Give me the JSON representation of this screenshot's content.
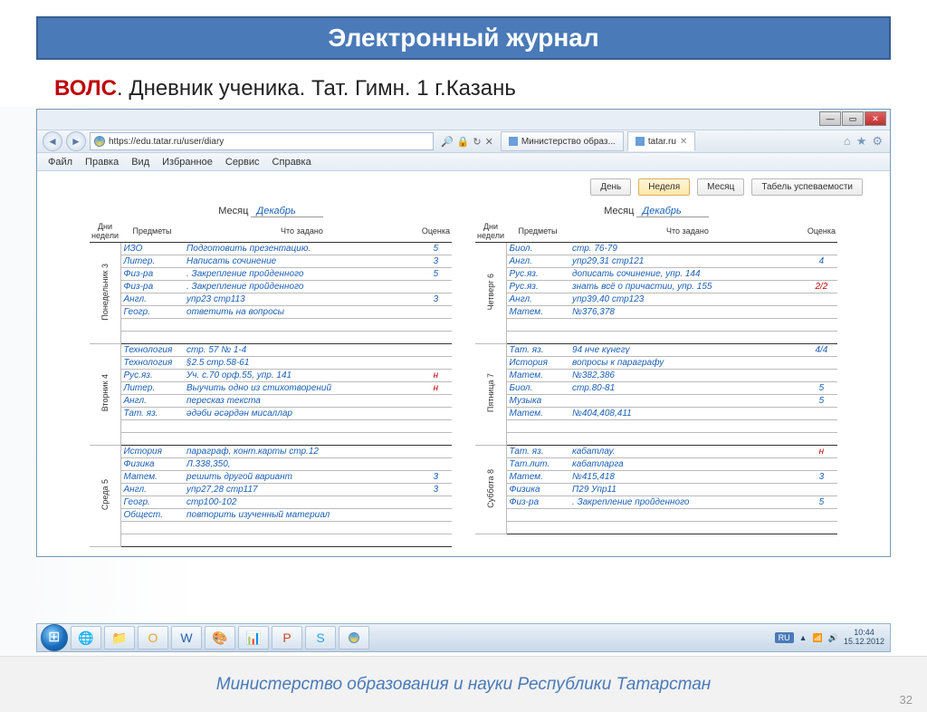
{
  "slide": {
    "title": "Электронный журнал",
    "subtitle_red": "ВОЛС",
    "subtitle_rest": ".  Дневник ученика. Тат. Гимн. 1  г.Казань",
    "footer": "Министерство образования и науки Республики Татарстан",
    "number": "32"
  },
  "browser": {
    "url": "https://edu.tatar.ru/user/diary",
    "tab1": "Министерство образ...",
    "tab2": "tatar.ru",
    "menu": [
      "Файл",
      "Правка",
      "Вид",
      "Избранное",
      "Сервис",
      "Справка"
    ]
  },
  "toolbar": {
    "day": "День",
    "week": "Неделя",
    "month": "Месяц",
    "report": "Табель успеваемости"
  },
  "diary": {
    "month_label": "Месяц",
    "month_value": "Декабрь",
    "headers": {
      "day": "Дни недели",
      "subj": "Предметы",
      "task": "Что задано",
      "grade": "Оценка"
    },
    "left": [
      {
        "day": "Понедельник 3",
        "num": "3",
        "rows": [
          {
            "s": "ИЗО",
            "t": "Подготовить презентацию.",
            "g": "5"
          },
          {
            "s": "Литер.",
            "t": "Написать сочинение",
            "g": "3"
          },
          {
            "s": "Физ-ра",
            "t": ". Закрепление пройденного",
            "g": "5"
          },
          {
            "s": "Физ-ра",
            "t": ". Закрепление пройденного",
            "g": ""
          },
          {
            "s": "Англ.",
            "t": "упр23 стр113",
            "g": "3"
          },
          {
            "s": "Геогр.",
            "t": "ответить на вопросы",
            "g": ""
          }
        ]
      },
      {
        "day": "Вторник 4",
        "num": "4",
        "rows": [
          {
            "s": "Технология",
            "t": "стр. 57 № 1-4",
            "g": ""
          },
          {
            "s": "Технология",
            "t": "§2.5 стр.58-61",
            "g": ""
          },
          {
            "s": "Рус.яз.",
            "t": "Уч. с.70 орф.55, упр. 141",
            "g": "н",
            "red": true
          },
          {
            "s": "Литер.",
            "t": "Выучить одно из стихотворений",
            "g": "н",
            "red": true
          },
          {
            "s": "Англ.",
            "t": "пересказ текста",
            "g": ""
          },
          {
            "s": "Тат. яз.",
            "t": "әдәби әсәрдән мисаллар",
            "g": ""
          }
        ]
      },
      {
        "day": "Среда 5",
        "num": "5",
        "rows": [
          {
            "s": "История",
            "t": "параграф, конт.карты стр.12",
            "g": ""
          },
          {
            "s": "Физика",
            "t": "Л.338,350,",
            "g": ""
          },
          {
            "s": "Матем.",
            "t": "решить другой вариант",
            "g": "3"
          },
          {
            "s": "Англ.",
            "t": "упр27,28 стр117",
            "g": "3"
          },
          {
            "s": "Геогр.",
            "t": "стр100-102",
            "g": ""
          },
          {
            "s": "Общест.",
            "t": "повторить изученный материал",
            "g": ""
          }
        ]
      }
    ],
    "right": [
      {
        "day": "Четверг 6",
        "num": "6",
        "rows": [
          {
            "s": "Биол.",
            "t": "стр. 76-79",
            "g": ""
          },
          {
            "s": "Англ.",
            "t": "упр29,31 стр121",
            "g": "4"
          },
          {
            "s": "Рус.яз.",
            "t": "дописать сочинение, упр. 144",
            "g": ""
          },
          {
            "s": "Рус.яз.",
            "t": "знать всё о причастии, упр. 155",
            "g": "2/2",
            "red": true
          },
          {
            "s": "Англ.",
            "t": "упр39,40 стр123",
            "g": ""
          },
          {
            "s": "Матем.",
            "t": "№376,378",
            "g": ""
          }
        ]
      },
      {
        "day": "Пятница 7",
        "num": "7",
        "rows": [
          {
            "s": "Тат. яз.",
            "t": "94 нче күнегү",
            "g": "4/4"
          },
          {
            "s": "История",
            "t": "вопросы к параграфу",
            "g": ""
          },
          {
            "s": "Матем.",
            "t": "№382,386",
            "g": ""
          },
          {
            "s": "Биол.",
            "t": "стр.80-81",
            "g": "5"
          },
          {
            "s": "Музыка",
            "t": "",
            "g": "5"
          },
          {
            "s": "Матем.",
            "t": "№404,408,411",
            "g": ""
          }
        ]
      },
      {
        "day": "Суббота 8",
        "num": "8",
        "rows": [
          {
            "s": "Тат. яз.",
            "t": "кабатлау.",
            "g": "н",
            "red": true
          },
          {
            "s": "Тат.лит.",
            "t": "кабатларга",
            "g": ""
          },
          {
            "s": "Матем.",
            "t": "№415,418",
            "g": "3"
          },
          {
            "s": "Физика",
            "t": "П29 Упр11",
            "g": ""
          },
          {
            "s": "Физ-ра",
            "t": ". Закрепление пройденного",
            "g": "5"
          }
        ]
      }
    ]
  },
  "tray": {
    "lang": "RU",
    "time": "10:44",
    "date": "15.12.2012"
  }
}
